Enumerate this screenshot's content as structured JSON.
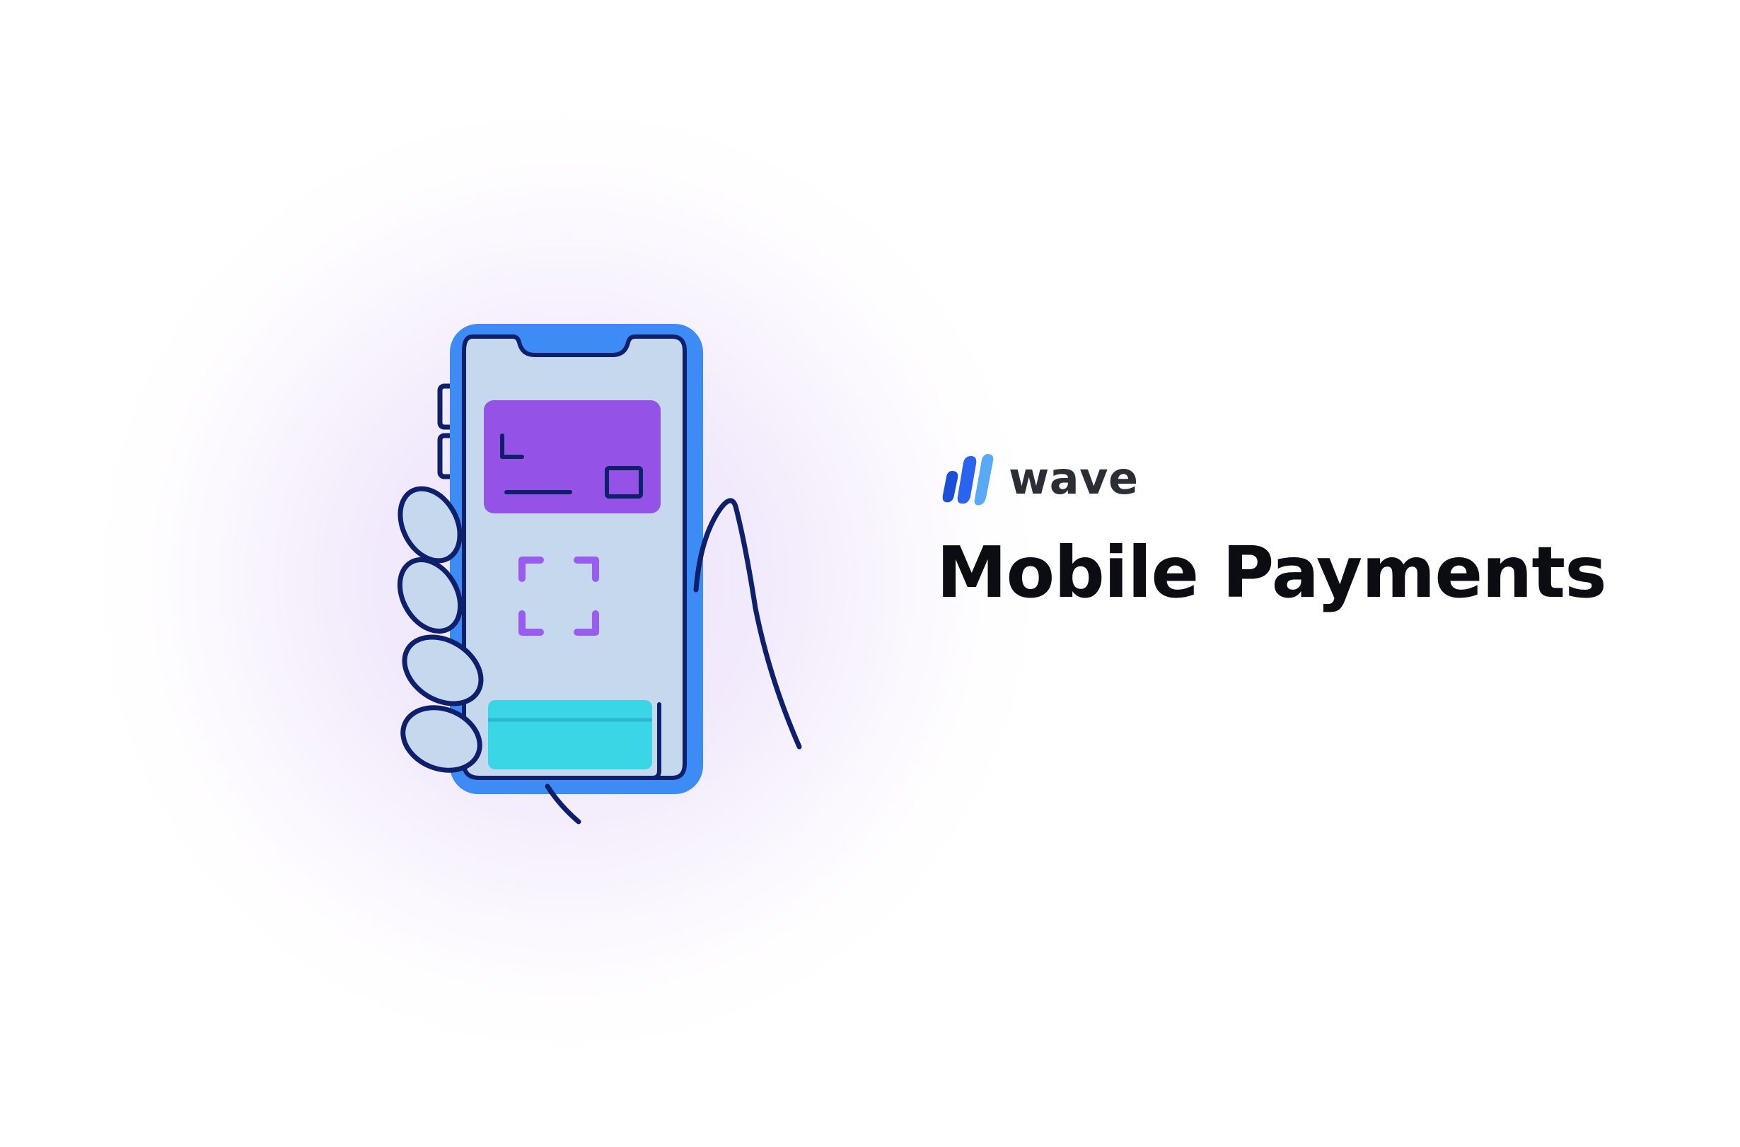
{
  "brand": {
    "name": "wave",
    "colors": {
      "mark_dark": "#1c4ed8",
      "mark_light": "#5aa9f5",
      "wordmark": "#2b2e35"
    }
  },
  "headline": "Mobile Payments",
  "illustration": {
    "icon": "hand-holding-phone-icon",
    "colors": {
      "phone_frame": "#3d8bf5",
      "screen": "#c5d8ee",
      "card": "#9452e6",
      "scan_frame": "#9a5cf0",
      "bottom_button": "#3ad6e6",
      "outline": "#0e1f6b"
    }
  },
  "background": {
    "glow_color": "#efe6fa"
  }
}
